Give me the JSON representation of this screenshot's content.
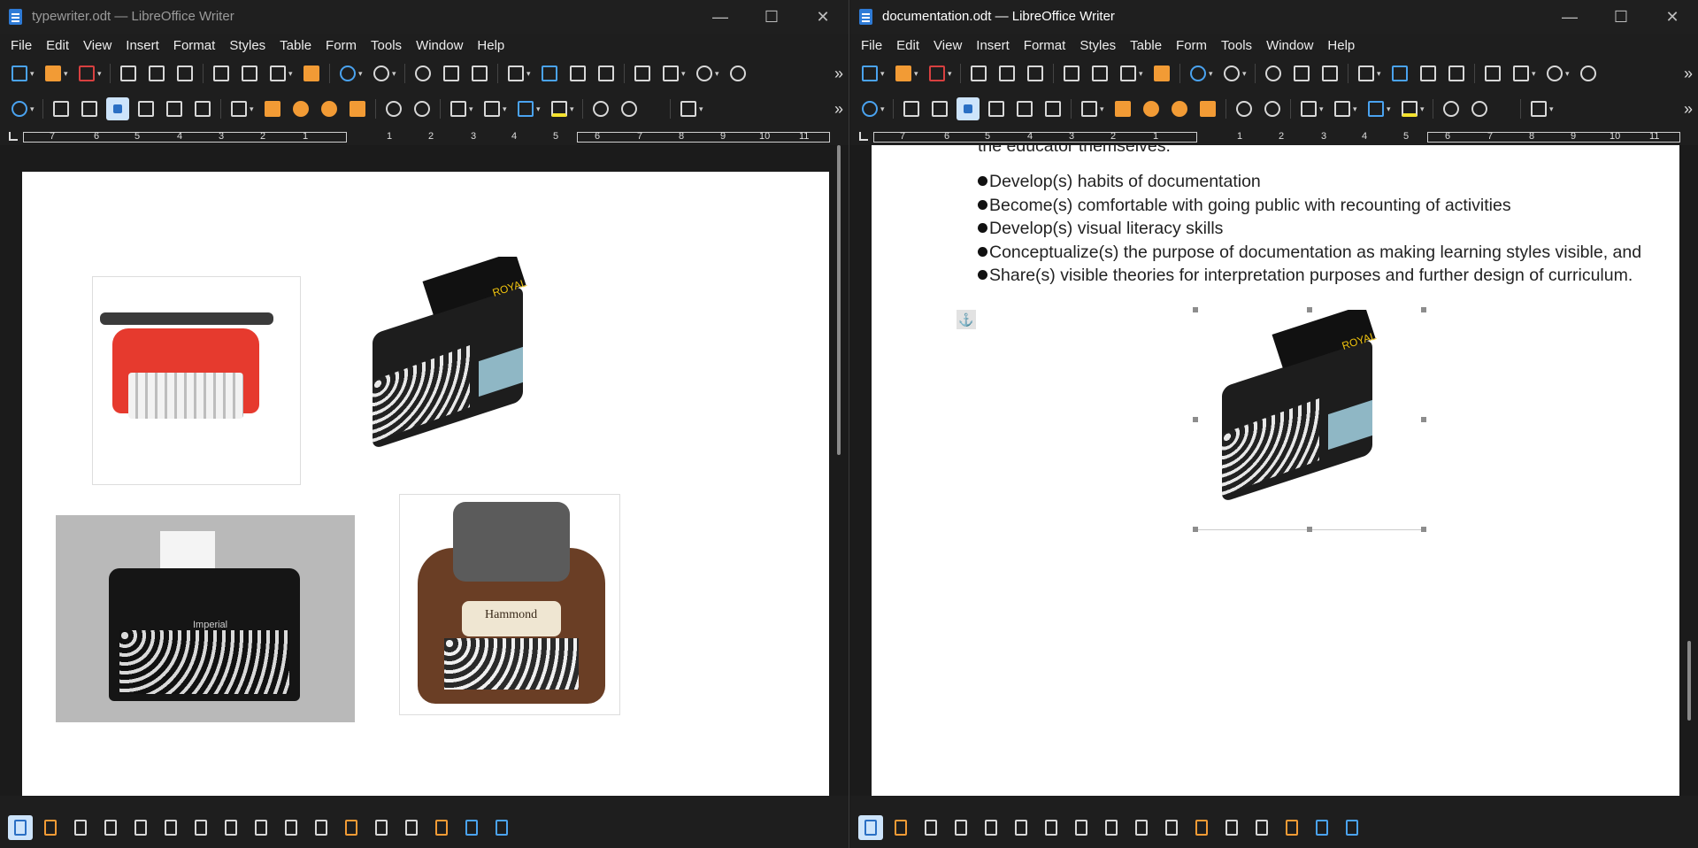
{
  "left_window": {
    "title": "typewriter.odt — LibreOffice Writer",
    "menu": [
      "File",
      "Edit",
      "View",
      "Insert",
      "Format",
      "Styles",
      "Table",
      "Form",
      "Tools",
      "Window",
      "Help"
    ]
  },
  "right_window": {
    "title": "documentation.odt — LibreOffice Writer",
    "menu": [
      "File",
      "Edit",
      "View",
      "Insert",
      "Format",
      "Styles",
      "Table",
      "Form",
      "Tools",
      "Window",
      "Help"
    ],
    "partial_line": "the educator themselves.",
    "bullets": [
      "Develop(s) habits of documentation",
      "Become(s) comfortable with going public with recounting of activities",
      "Develop(s) visual literacy skills",
      "Conceptualize(s) the purpose of documentation as making learning styles visible, and",
      "Share(s) visible theories for interpretation purposes and further design of curriculum."
    ]
  },
  "ruler_ticks": [
    "7",
    "6",
    "5",
    "4",
    "3",
    "2",
    "1",
    "1",
    "2",
    "3",
    "4",
    "5",
    "6",
    "7",
    "8",
    "9",
    "10",
    "11"
  ],
  "window_controls": {
    "minimize": "—",
    "maximize": "☐",
    "close": "✕"
  },
  "toolbar_overflow": "»",
  "dropdown_caret": "▾",
  "anchor_glyph": "⚓",
  "images": {
    "red": {
      "alt": "Red typewriter"
    },
    "royal": {
      "alt": "Royal typewriter",
      "brand": "ROYAL"
    },
    "imperial": {
      "alt": "Imperial typewriter",
      "brand": "Imperial"
    },
    "hammond": {
      "alt": "Hammond typewriter",
      "brand": "Hammond"
    }
  },
  "colors": {
    "accent_blue": "#2e7bd6",
    "selection": "#cde4fb",
    "orange": "#f29b35"
  }
}
